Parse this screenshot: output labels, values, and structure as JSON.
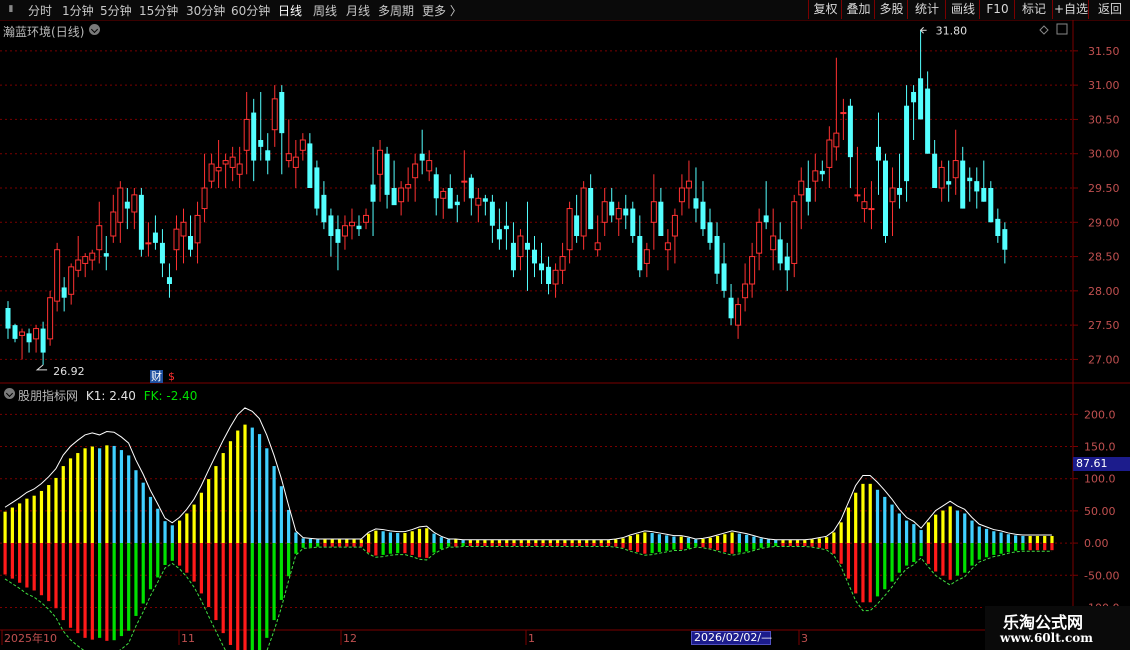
{
  "toolbar": {
    "periods": [
      "分时",
      "1分钟",
      "5分钟",
      "15分钟",
      "30分钟",
      "60分钟",
      "日线",
      "周线",
      "月线",
      "多周期",
      "更多"
    ],
    "active_period": "日线",
    "right_buttons": [
      "复权",
      "叠加",
      "多股",
      "统计",
      "画线",
      "F10",
      "标记",
      "+自选",
      "返回"
    ]
  },
  "stock": {
    "name": "瀚蓝环境",
    "period_tag": "(日线)"
  },
  "price_panel": {
    "y_ticks": [
      "31.50",
      "31.00",
      "30.50",
      "30.00",
      "29.50",
      "29.00",
      "28.50",
      "28.00",
      "27.50",
      "27.00"
    ],
    "high_label": "31.80",
    "low_label": "26.92",
    "finance_icon": "财",
    "dollar_icon": "$"
  },
  "indicator": {
    "name": "股朋指标网",
    "k1_label": "K1: 2.40",
    "fk_label": "FK: -2.40",
    "y_ticks": [
      "200.0",
      "150.0",
      "100.0",
      "50.00",
      "0.00",
      "-50.00",
      "-100.0"
    ],
    "current_value": "87.61"
  },
  "x_axis": {
    "labels": [
      "2025年10",
      "11",
      "12",
      "1",
      "3"
    ],
    "cursor_date": "2026/02/02/—"
  },
  "watermark": {
    "line1": "乐淘公式网",
    "line2": "www.60lt.com"
  },
  "colors": {
    "up": "#ff3232",
    "down": "#54ffff",
    "grid": "#7a0000",
    "yellow": "#ffff00",
    "green": "#00e000",
    "red": "#ff1a1a",
    "cyan": "#40d0ff"
  },
  "chart_data": [
    {
      "type": "candlestick",
      "title": "瀚蓝环境(日线)",
      "ylim": [
        26.7,
        31.95
      ],
      "candles": [
        [
          27.75,
          27.85,
          27.3,
          27.45
        ],
        [
          27.5,
          27.52,
          27.25,
          27.3
        ],
        [
          27.35,
          27.45,
          27.0,
          27.4
        ],
        [
          27.38,
          27.45,
          27.1,
          27.25
        ],
        [
          27.3,
          27.5,
          27.1,
          27.45
        ],
        [
          27.45,
          27.55,
          26.92,
          27.1
        ],
        [
          27.3,
          28.0,
          27.2,
          27.9
        ],
        [
          27.85,
          28.7,
          27.7,
          28.6
        ],
        [
          28.05,
          28.2,
          27.7,
          27.9
        ],
        [
          27.95,
          28.4,
          27.8,
          28.35
        ],
        [
          28.3,
          28.8,
          28.2,
          28.45
        ],
        [
          28.4,
          28.55,
          28.2,
          28.5
        ],
        [
          28.45,
          28.6,
          28.3,
          28.55
        ],
        [
          28.6,
          29.3,
          28.4,
          28.95
        ],
        [
          28.55,
          28.8,
          28.3,
          28.5
        ],
        [
          28.8,
          29.4,
          28.7,
          29.15
        ],
        [
          29.0,
          29.6,
          28.7,
          29.5
        ],
        [
          29.3,
          29.5,
          28.9,
          29.2
        ],
        [
          29.15,
          29.5,
          28.9,
          29.4
        ],
        [
          29.4,
          29.5,
          28.5,
          28.6
        ],
        [
          28.7,
          29.0,
          28.5,
          28.7
        ],
        [
          28.85,
          29.1,
          28.6,
          28.7
        ],
        [
          28.7,
          28.9,
          28.2,
          28.4
        ],
        [
          28.2,
          28.4,
          27.9,
          28.1
        ],
        [
          28.6,
          29.1,
          28.3,
          28.9
        ],
        [
          28.8,
          29.2,
          28.4,
          29.0
        ],
        [
          28.8,
          29.1,
          28.5,
          28.6
        ],
        [
          28.7,
          29.3,
          28.4,
          29.1
        ],
        [
          29.2,
          30.0,
          29.0,
          29.5
        ],
        [
          29.6,
          30.0,
          29.5,
          29.85
        ],
        [
          29.75,
          30.2,
          29.5,
          29.8
        ],
        [
          29.85,
          30.0,
          29.5,
          29.9
        ],
        [
          29.8,
          30.1,
          29.6,
          29.95
        ],
        [
          29.7,
          30.1,
          29.5,
          29.85
        ],
        [
          30.05,
          30.9,
          29.7,
          30.5
        ],
        [
          30.6,
          30.8,
          29.6,
          29.9
        ],
        [
          30.2,
          30.9,
          29.9,
          30.1
        ],
        [
          30.05,
          30.3,
          29.7,
          29.9
        ],
        [
          30.35,
          31.0,
          30.1,
          30.8
        ],
        [
          30.9,
          31.0,
          29.7,
          30.3
        ],
        [
          29.9,
          30.5,
          29.8,
          30.0
        ],
        [
          29.8,
          30.2,
          29.5,
          29.95
        ],
        [
          30.05,
          30.3,
          29.9,
          30.2
        ],
        [
          30.15,
          30.3,
          29.5,
          29.5
        ],
        [
          29.8,
          29.9,
          29.1,
          29.2
        ],
        [
          29.4,
          29.6,
          28.9,
          29.0
        ],
        [
          29.1,
          29.2,
          28.5,
          28.8
        ],
        [
          28.9,
          29.1,
          28.3,
          28.7
        ],
        [
          28.8,
          29.1,
          28.6,
          28.95
        ],
        [
          28.95,
          29.2,
          28.75,
          29.0
        ],
        [
          28.95,
          29.1,
          28.8,
          28.9
        ],
        [
          29.0,
          29.2,
          28.9,
          29.1
        ],
        [
          29.55,
          30.1,
          28.8,
          29.3
        ],
        [
          29.7,
          30.2,
          29.3,
          30.05
        ],
        [
          30.0,
          30.1,
          29.2,
          29.4
        ],
        [
          29.5,
          29.9,
          29.3,
          29.25
        ],
        [
          29.3,
          29.6,
          29.1,
          29.5
        ],
        [
          29.5,
          29.8,
          29.3,
          29.55
        ],
        [
          29.65,
          30.0,
          29.3,
          29.85
        ],
        [
          30.0,
          30.35,
          29.7,
          29.9
        ],
        [
          29.75,
          30.05,
          29.6,
          29.9
        ],
        [
          29.7,
          29.8,
          29.1,
          29.35
        ],
        [
          29.35,
          29.5,
          29.05,
          29.45
        ],
        [
          29.5,
          29.7,
          29.3,
          29.2
        ],
        [
          29.3,
          29.4,
          29.0,
          29.25
        ],
        [
          29.6,
          30.05,
          29.3,
          29.6
        ],
        [
          29.65,
          29.7,
          29.1,
          29.35
        ],
        [
          29.25,
          29.5,
          29.0,
          29.35
        ],
        [
          29.35,
          29.4,
          29.1,
          29.3
        ],
        [
          29.3,
          29.4,
          28.7,
          28.95
        ],
        [
          28.9,
          29.2,
          28.6,
          28.75
        ],
        [
          28.95,
          29.3,
          28.6,
          28.9
        ],
        [
          28.7,
          29.0,
          28.2,
          28.3
        ],
        [
          28.5,
          28.9,
          28.3,
          28.8
        ],
        [
          28.7,
          29.3,
          28.0,
          28.6
        ],
        [
          28.6,
          28.8,
          28.2,
          28.4
        ],
        [
          28.4,
          28.7,
          28.1,
          28.3
        ],
        [
          28.35,
          28.5,
          27.95,
          28.1
        ],
        [
          28.1,
          28.4,
          27.9,
          28.3
        ],
        [
          28.3,
          28.7,
          28.1,
          28.5
        ],
        [
          28.6,
          29.3,
          28.4,
          29.2
        ],
        [
          29.1,
          29.4,
          28.7,
          28.8
        ],
        [
          28.8,
          29.6,
          28.6,
          29.5
        ],
        [
          29.5,
          29.7,
          28.9,
          28.9
        ],
        [
          28.6,
          29.1,
          28.5,
          28.7
        ],
        [
          29.0,
          29.5,
          28.8,
          29.3
        ],
        [
          29.3,
          29.5,
          29.0,
          29.1
        ],
        [
          29.05,
          29.3,
          28.8,
          29.2
        ],
        [
          29.2,
          29.4,
          28.9,
          29.1
        ],
        [
          29.2,
          29.3,
          28.7,
          28.8
        ],
        [
          28.8,
          29.1,
          28.2,
          28.3
        ],
        [
          28.4,
          28.7,
          28.2,
          28.6
        ],
        [
          29.0,
          29.7,
          28.6,
          29.3
        ],
        [
          29.3,
          29.5,
          28.8,
          28.8
        ],
        [
          28.6,
          28.9,
          28.3,
          28.7
        ],
        [
          28.8,
          29.2,
          28.4,
          29.1
        ],
        [
          29.3,
          29.7,
          29.1,
          29.5
        ],
        [
          29.5,
          29.9,
          29.2,
          29.6
        ],
        [
          29.35,
          29.8,
          29.0,
          29.2
        ],
        [
          29.3,
          29.6,
          28.8,
          28.9
        ],
        [
          29.0,
          29.2,
          28.6,
          28.7
        ],
        [
          28.8,
          29.0,
          28.1,
          28.25
        ],
        [
          28.4,
          28.7,
          27.9,
          28.0
        ],
        [
          27.9,
          28.1,
          27.5,
          27.6
        ],
        [
          27.5,
          27.9,
          27.3,
          27.8
        ],
        [
          27.9,
          28.4,
          27.7,
          28.1
        ],
        [
          28.1,
          28.7,
          27.9,
          28.5
        ],
        [
          28.55,
          29.2,
          28.3,
          29.0
        ],
        [
          29.1,
          29.6,
          28.9,
          29.0
        ],
        [
          28.6,
          29.2,
          28.3,
          28.8
        ],
        [
          28.75,
          29.0,
          28.3,
          28.4
        ],
        [
          28.5,
          28.7,
          28.0,
          28.3
        ],
        [
          28.4,
          29.4,
          28.2,
          29.3
        ],
        [
          29.4,
          29.8,
          28.9,
          29.6
        ],
        [
          29.5,
          29.9,
          29.1,
          29.3
        ],
        [
          29.6,
          30.0,
          29.3,
          29.75
        ],
        [
          29.75,
          29.9,
          29.6,
          29.7
        ],
        [
          29.8,
          30.4,
          29.5,
          30.2
        ],
        [
          30.1,
          31.4,
          29.9,
          30.3
        ],
        [
          30.6,
          30.8,
          30.2,
          30.6
        ],
        [
          30.7,
          30.8,
          29.5,
          29.95
        ],
        [
          29.4,
          30.1,
          29.3,
          29.4
        ],
        [
          29.2,
          29.5,
          29.0,
          29.3
        ],
        [
          29.2,
          29.6,
          28.9,
          29.2
        ],
        [
          30.1,
          30.6,
          29.4,
          29.9
        ],
        [
          29.9,
          30.0,
          28.7,
          28.8
        ],
        [
          29.3,
          29.8,
          28.8,
          29.5
        ],
        [
          29.5,
          30.0,
          29.2,
          29.4
        ],
        [
          30.7,
          31.0,
          29.3,
          29.6
        ],
        [
          30.9,
          31.0,
          30.2,
          30.75
        ],
        [
          31.1,
          31.8,
          30.5,
          30.5
        ],
        [
          30.95,
          31.2,
          30.0,
          30.0
        ],
        [
          30.0,
          30.2,
          29.5,
          29.5
        ],
        [
          29.5,
          29.9,
          29.3,
          29.8
        ],
        [
          29.6,
          29.9,
          29.3,
          29.55
        ],
        [
          29.65,
          30.35,
          29.4,
          29.9
        ],
        [
          29.9,
          30.1,
          29.2,
          29.2
        ],
        [
          29.65,
          29.8,
          29.3,
          29.6
        ],
        [
          29.6,
          29.8,
          29.2,
          29.45
        ],
        [
          29.5,
          29.9,
          29.3,
          29.3
        ],
        [
          29.5,
          29.6,
          29.0,
          29.0
        ],
        [
          29.05,
          29.2,
          28.7,
          28.8
        ],
        [
          28.9,
          29.0,
          28.4,
          28.6
        ]
      ],
      "high_label": "31.80",
      "low_label": "26.92"
    },
    {
      "type": "bar",
      "title": "股朋指标网",
      "ylim": [
        -135,
        230
      ],
      "values": [
        53,
        60,
        67,
        75,
        80,
        88,
        98,
        110,
        130,
        143,
        152,
        160,
        163,
        160,
        165,
        164,
        157,
        148,
        123,
        102,
        78,
        58,
        37,
        30,
        38,
        50,
        65,
        85,
        108,
        130,
        152,
        172,
        190,
        200,
        195,
        184,
        160,
        130,
        96,
        56,
        18,
        8,
        7,
        6,
        6,
        6,
        6,
        6,
        6,
        6,
        16,
        21,
        20,
        18,
        17,
        17,
        20,
        24,
        25,
        16,
        10,
        6,
        6,
        5,
        5,
        5,
        5,
        5,
        5,
        5,
        5,
        5,
        5,
        5,
        5,
        5,
        5,
        5,
        5,
        5,
        5,
        5,
        5,
        5,
        6,
        8,
        12,
        15,
        18,
        17,
        15,
        13,
        11,
        11,
        9,
        6,
        7,
        9,
        12,
        15,
        18,
        16,
        14,
        11,
        8,
        6,
        5,
        5,
        5,
        5,
        5,
        6,
        8,
        10,
        18,
        35,
        60,
        85,
        100,
        100,
        90,
        78,
        65,
        50,
        38,
        32,
        22,
        35,
        48,
        55,
        62,
        55,
        50,
        38,
        28,
        24,
        20,
        18,
        15,
        13,
        12,
        12,
        12,
        12,
        12
      ],
      "k1_label": "K1: 2.40",
      "fk_label": "FK: -2.40",
      "current_value": "87.61"
    }
  ]
}
